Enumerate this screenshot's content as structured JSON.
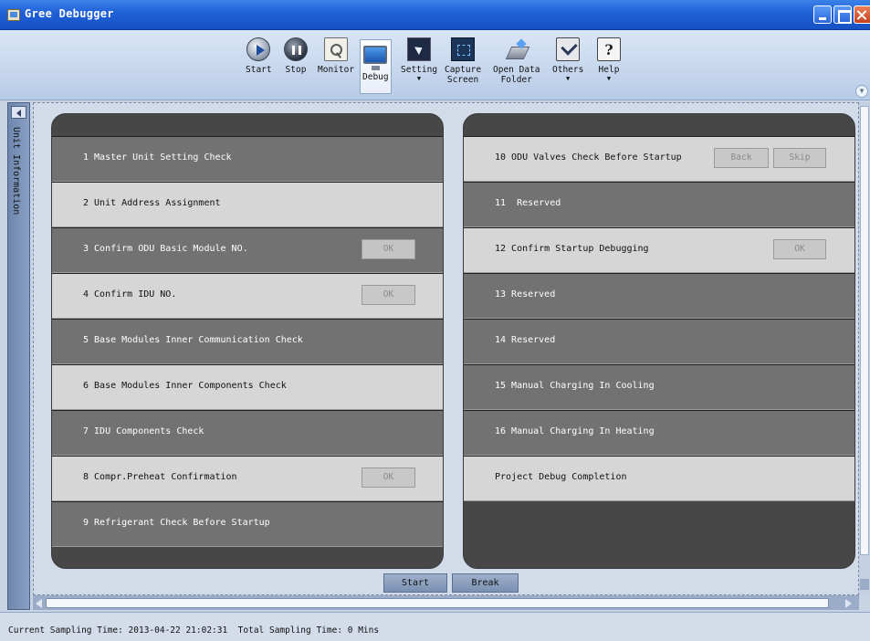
{
  "window": {
    "title": "Gree Debugger"
  },
  "toolbar": {
    "items": [
      {
        "label": "Start",
        "caret": ""
      },
      {
        "label": "Stop",
        "caret": ""
      },
      {
        "label": "Monitor",
        "caret": ""
      },
      {
        "label": "Debug",
        "caret": ""
      },
      {
        "label": "Setting",
        "caret": "▼"
      },
      {
        "label": "Capture\nScreen",
        "caret": ""
      },
      {
        "label": "Open Data\nFolder",
        "caret": ""
      },
      {
        "label": "Others",
        "caret": "▼"
      },
      {
        "label": "Help",
        "caret": "▼"
      }
    ]
  },
  "sidebar": {
    "label": "Unit Information"
  },
  "left_panel": {
    "rows": [
      {
        "label": "1 Master Unit Setting Check"
      },
      {
        "label": "2 Unit Address Assignment"
      },
      {
        "label": "3 Confirm ODU Basic Module NO.",
        "button": "OK"
      },
      {
        "label": "4 Confirm IDU NO.",
        "button": "OK"
      },
      {
        "label": "5 Base Modules Inner Communication Check"
      },
      {
        "label": "6 Base Modules Inner Components Check"
      },
      {
        "label": "7 IDU Components Check"
      },
      {
        "label": "8 Compr.Preheat Confirmation",
        "button": "OK"
      },
      {
        "label": "9 Refrigerant Check Before Startup"
      }
    ]
  },
  "right_panel": {
    "rows": [
      {
        "label": "10 ODU Valves Check Before Startup",
        "buttons": [
          "Back",
          "Skip"
        ]
      },
      {
        "label": "11  Reserved"
      },
      {
        "label": "12 Confirm Startup Debugging",
        "button": "OK"
      },
      {
        "label": "13 Reserved"
      },
      {
        "label": "14 Reserved"
      },
      {
        "label": "15 Manual Charging In Cooling"
      },
      {
        "label": "16 Manual Charging In Heating"
      },
      {
        "label": "Project Debug Completion"
      }
    ]
  },
  "actions": {
    "start": "Start",
    "break": "Break"
  },
  "status": {
    "text": "Current Sampling Time: 2013-04-22 21:02:31  Total Sampling Time: 0 Mins"
  }
}
